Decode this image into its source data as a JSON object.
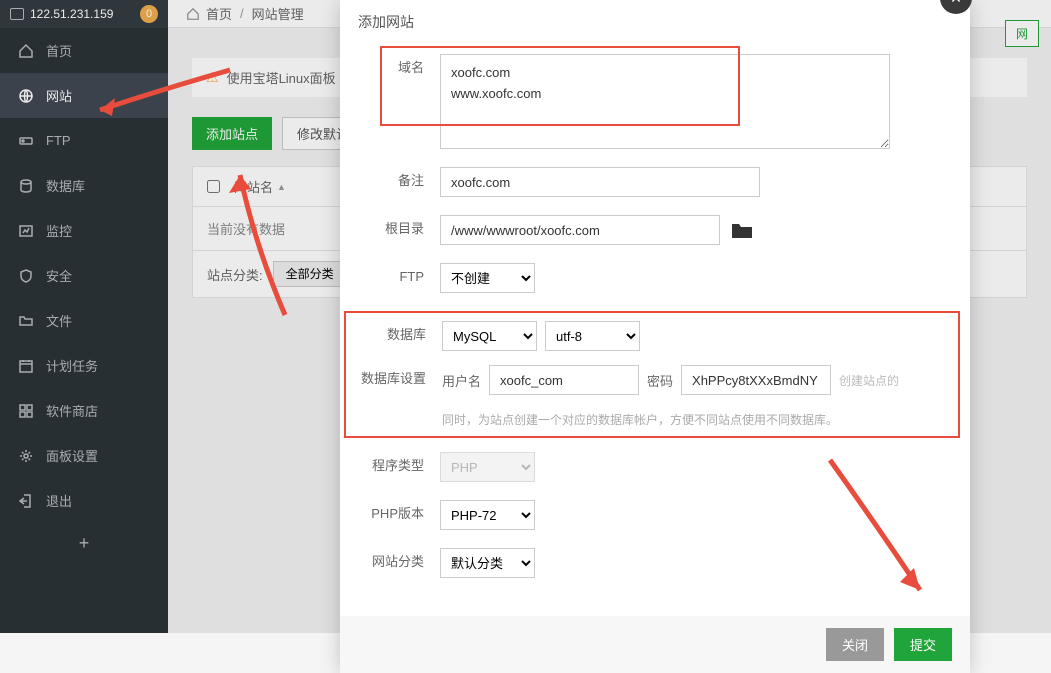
{
  "header": {
    "ip": "122.51.231.159",
    "badge": "0"
  },
  "sidebar": {
    "items": [
      {
        "label": "首页",
        "icon": "home"
      },
      {
        "label": "网站",
        "icon": "globe",
        "active": true
      },
      {
        "label": "FTP",
        "icon": "ftp"
      },
      {
        "label": "数据库",
        "icon": "database"
      },
      {
        "label": "监控",
        "icon": "monitor"
      },
      {
        "label": "安全",
        "icon": "shield"
      },
      {
        "label": "文件",
        "icon": "folder"
      },
      {
        "label": "计划任务",
        "icon": "calendar"
      },
      {
        "label": "软件商店",
        "icon": "apps"
      },
      {
        "label": "面板设置",
        "icon": "gear"
      },
      {
        "label": "退出",
        "icon": "exit"
      }
    ]
  },
  "breadcrumb": {
    "home": "首页",
    "current": "网站管理"
  },
  "panel_button": "网",
  "alert_text": "使用宝塔Linux面板",
  "actions": {
    "add_site": "添加站点",
    "modify_default": "修改默认"
  },
  "table": {
    "col_name": "网站名",
    "empty_text": "当前没有数据",
    "filter_label": "站点分类:",
    "filter_all": "全部分类"
  },
  "modal": {
    "title": "添加网站",
    "labels": {
      "domain": "域名",
      "note": "备注",
      "root": "根目录",
      "ftp": "FTP",
      "database": "数据库",
      "db_settings": "数据库设置",
      "username": "用户名",
      "password": "密码",
      "program_type": "程序类型",
      "php_version": "PHP版本",
      "site_category": "网站分类"
    },
    "values": {
      "domain": "xoofc.com\nwww.xoofc.com",
      "note": "xoofc.com",
      "root": "/www/wwwroot/xoofc.com",
      "ftp": "不创建",
      "db_type": "MySQL",
      "db_charset": "utf-8",
      "db_user": "xoofc_com",
      "db_password": "XhPPcy8tXXxBmdNY",
      "program": "PHP",
      "php_version": "PHP-72",
      "category": "默认分类"
    },
    "hints": {
      "db": "同时，为站点创建一个对应的数据库帐户，方便不同站点使用不同数据库。",
      "create_site": "创建站点的"
    },
    "footer": {
      "close": "关闭",
      "submit": "提交"
    }
  }
}
